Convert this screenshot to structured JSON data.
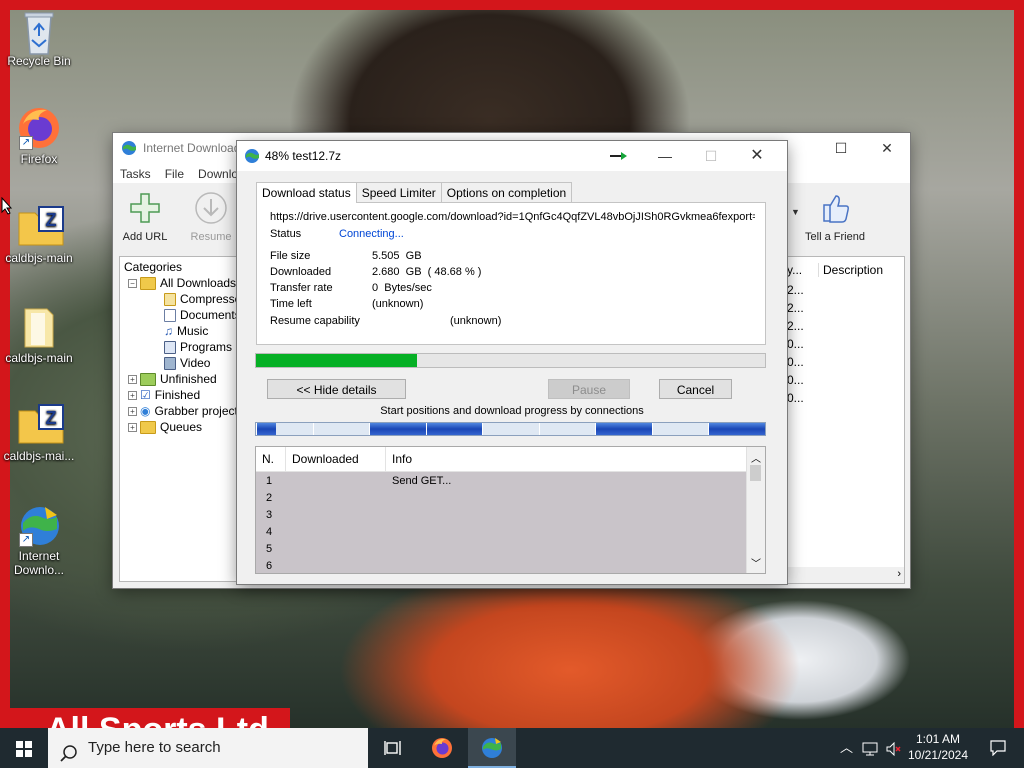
{
  "desktop": {
    "icons": [
      {
        "label": "Recycle Bin"
      },
      {
        "label": "Firefox"
      },
      {
        "label": "caldbjs-main"
      },
      {
        "label": "caldbjs-main"
      },
      {
        "label": "caldbjs-mai..."
      },
      {
        "label": "Internet Downlo..."
      }
    ],
    "wallpaper_banner": "All Sports Ltd"
  },
  "idm_main": {
    "title": "Internet Download Manager",
    "menu": [
      "Tasks",
      "File",
      "Downloads"
    ],
    "toolbar": {
      "add_url": "Add URL",
      "resume": "Resume",
      "tell_friend": "Tell a Friend"
    },
    "categories": {
      "header": "Categories",
      "all_downloads": "All Downloads",
      "compressed": "Compressed",
      "documents": "Documents",
      "music": "Music",
      "programs": "Programs",
      "video": "Video",
      "unfinished": "Unfinished",
      "finished": "Finished",
      "grabber": "Grabber projects",
      "queues": "Queues"
    },
    "list": {
      "col_partial": "y...",
      "col_description": "Description",
      "partial_values": [
        "2...",
        "2...",
        "2...",
        "0...",
        "0...",
        "0...",
        "0..."
      ]
    }
  },
  "dialog": {
    "title": "48% test12.7z",
    "tabs": [
      "Download status",
      "Speed Limiter",
      "Options on completion"
    ],
    "url": "https://drive.usercontent.google.com/download?id=1QnfGc4QqfZVL48vbOjJISh0RGvkmea6fexport=",
    "status_label": "Status",
    "status_value": "Connecting...",
    "file_size_label": "File size",
    "file_size_value": "5.505  GB",
    "downloaded_label": "Downloaded",
    "downloaded_value": "2.680  GB  ( 48.68 % )",
    "transfer_rate_label": "Transfer rate",
    "transfer_rate_value": "0  Bytes/sec",
    "time_left_label": "Time left",
    "time_left_value": "(unknown)",
    "resume_label": "Resume capability",
    "resume_value": "(unknown)",
    "progress_percent": 48.68,
    "hide_details_button": "<< Hide details",
    "pause_button": "Pause",
    "cancel_button": "Cancel",
    "connections_caption": "Start positions and download progress by connections",
    "connection_progress": [
      0.35,
      0.0,
      1.0,
      1.0,
      0.0,
      0.0,
      1.0,
      0.0,
      1.0
    ],
    "connection_table": {
      "headers": [
        "N.",
        "Downloaded",
        "Info"
      ],
      "rows": [
        {
          "n": "1",
          "downloaded": "",
          "info": "Send GET..."
        },
        {
          "n": "2",
          "downloaded": "",
          "info": ""
        },
        {
          "n": "3",
          "downloaded": "",
          "info": ""
        },
        {
          "n": "4",
          "downloaded": "",
          "info": ""
        },
        {
          "n": "5",
          "downloaded": "",
          "info": ""
        },
        {
          "n": "6",
          "downloaded": "",
          "info": ""
        }
      ]
    }
  },
  "taskbar": {
    "search_placeholder": "Type here to search",
    "time": "1:01 AM",
    "date": "10/21/2024"
  },
  "colors": {
    "progress_green": "#06b025",
    "connection_blue": "#1a46b5",
    "status_link": "#0046d5",
    "wallpaper_frame": "#d3161b"
  }
}
